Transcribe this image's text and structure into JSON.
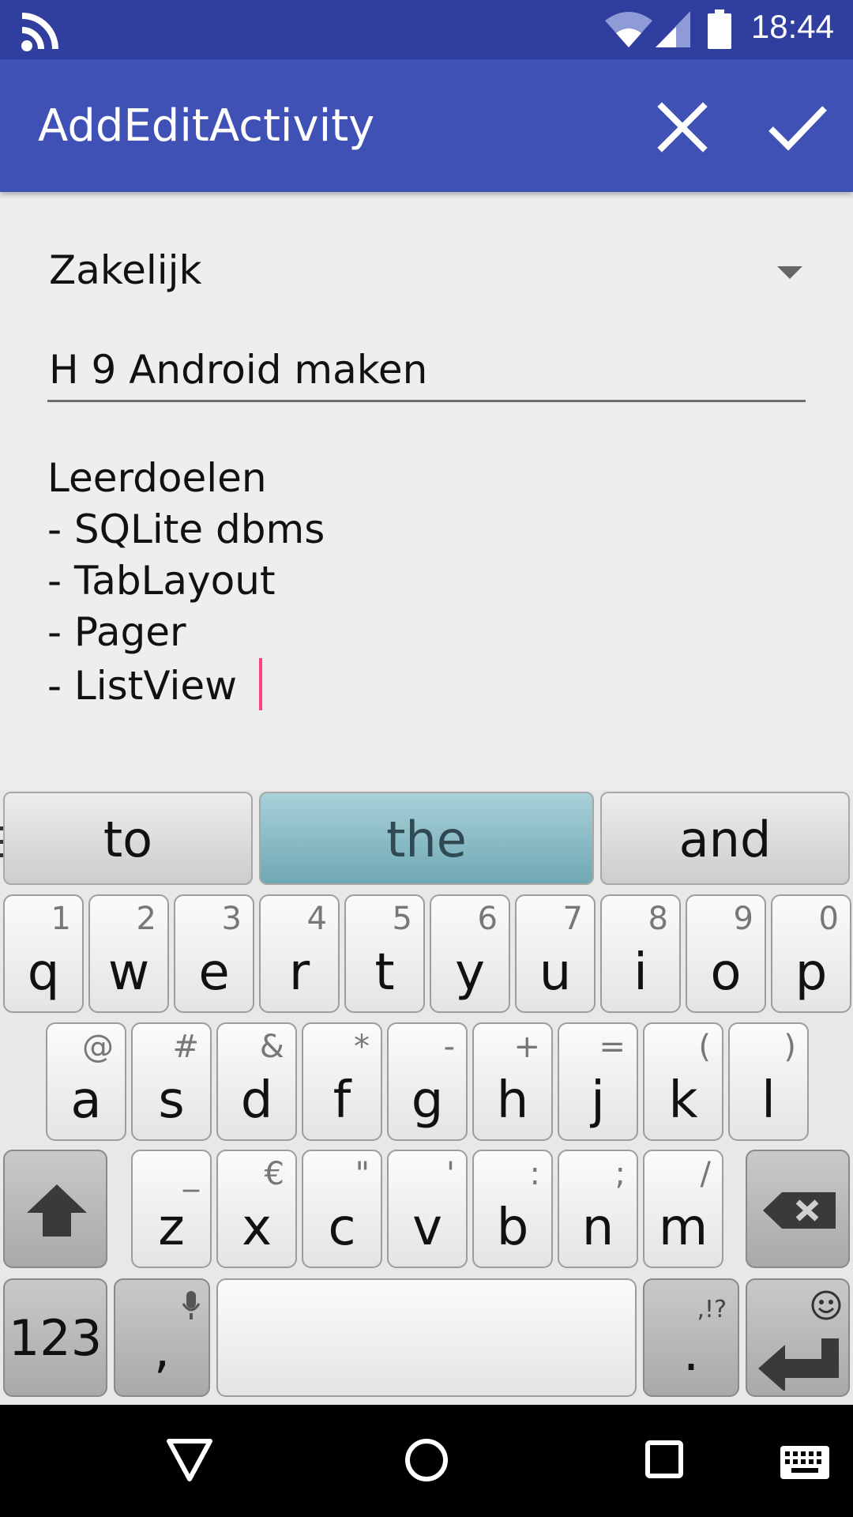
{
  "status_bar": {
    "time": "18:44",
    "icons": [
      "cast-icon",
      "wifi-icon",
      "signal-icon",
      "battery-icon"
    ]
  },
  "app_bar": {
    "title": "AddEditActivity",
    "cancel_icon": "close-icon",
    "confirm_icon": "check-icon"
  },
  "form": {
    "category": "Zakelijk",
    "title": "H 9 Android maken",
    "notes": [
      "Leerdoelen",
      "- SQLite dbms",
      "- TabLayout",
      "- Pager",
      "- ListView "
    ]
  },
  "keyboard": {
    "suggestions": [
      "to",
      "the",
      "and"
    ],
    "row1": [
      {
        "key": "q",
        "hint": "1"
      },
      {
        "key": "w",
        "hint": "2"
      },
      {
        "key": "e",
        "hint": "3"
      },
      {
        "key": "r",
        "hint": "4"
      },
      {
        "key": "t",
        "hint": "5"
      },
      {
        "key": "y",
        "hint": "6"
      },
      {
        "key": "u",
        "hint": "7"
      },
      {
        "key": "i",
        "hint": "8"
      },
      {
        "key": "o",
        "hint": "9"
      },
      {
        "key": "p",
        "hint": "0"
      }
    ],
    "row2": [
      {
        "key": "a",
        "hint": "@"
      },
      {
        "key": "s",
        "hint": "#"
      },
      {
        "key": "d",
        "hint": "&"
      },
      {
        "key": "f",
        "hint": "*"
      },
      {
        "key": "g",
        "hint": "-"
      },
      {
        "key": "h",
        "hint": "+"
      },
      {
        "key": "j",
        "hint": "="
      },
      {
        "key": "k",
        "hint": "("
      },
      {
        "key": "l",
        "hint": ")"
      }
    ],
    "row3": [
      {
        "key": "z",
        "hint": "_"
      },
      {
        "key": "x",
        "hint": "€"
      },
      {
        "key": "c",
        "hint": "\""
      },
      {
        "key": "v",
        "hint": "'"
      },
      {
        "key": "b",
        "hint": ":"
      },
      {
        "key": "n",
        "hint": ";"
      },
      {
        "key": "m",
        "hint": "/"
      }
    ],
    "mode_key": "123",
    "comma_key": ",",
    "period_key": ".",
    "period_hint": ",!?"
  },
  "nav_bar": {
    "icons": [
      "back-icon",
      "home-icon",
      "recents-icon",
      "keyboard-icon"
    ]
  },
  "colors": {
    "status_bar": "#303f9f",
    "app_bar": "#3f51b5",
    "caret": "#ff4081"
  }
}
